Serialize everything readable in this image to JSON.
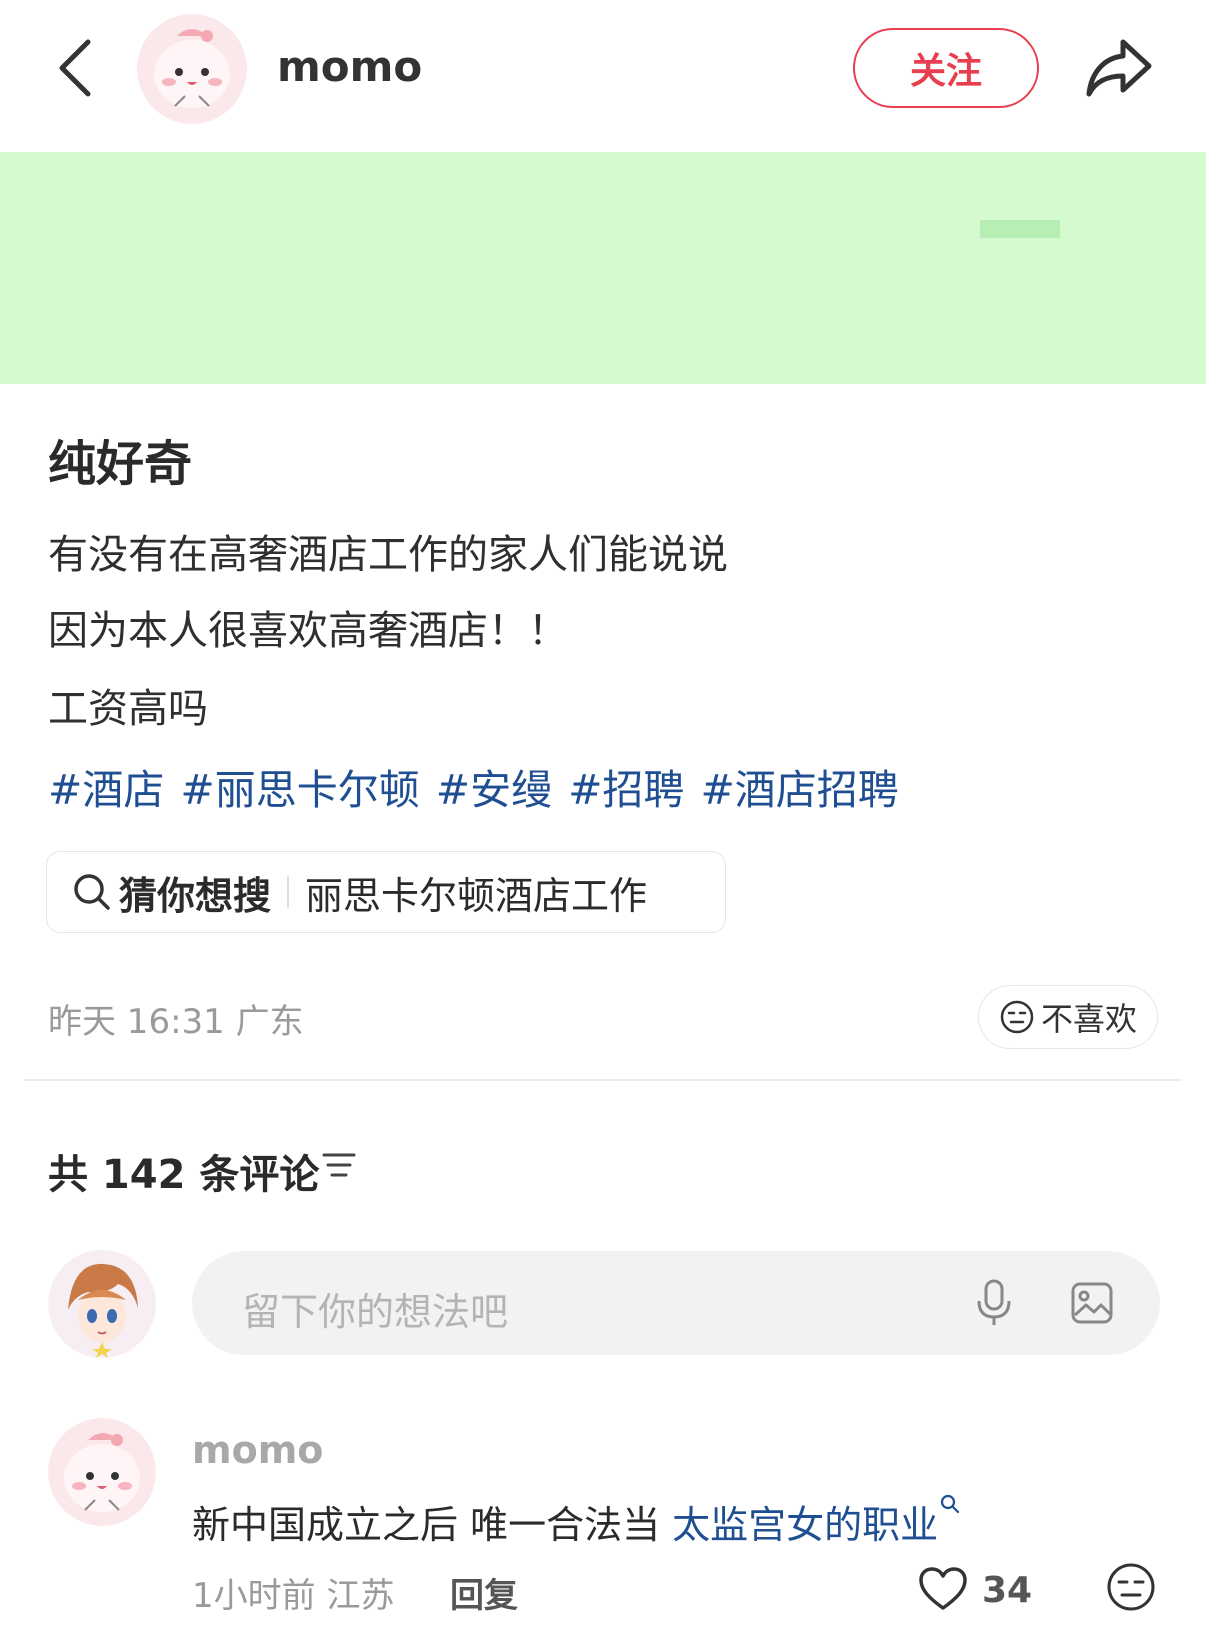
{
  "header": {
    "username": "momo",
    "follow_label": "关注",
    "icons": {
      "back": "chevron-left-icon",
      "share": "share-arrow-icon"
    }
  },
  "post": {
    "title": "纯好奇",
    "lines": [
      "有没有在高奢酒店工作的家人们能说说",
      "因为本人很喜欢高奢酒店！！",
      "工资高吗"
    ],
    "hashtags": [
      "#酒店",
      "#丽思卡尔顿",
      "#安缦",
      "#招聘",
      "#酒店招聘"
    ],
    "search_suggest": {
      "label": "猜你想搜",
      "query": "丽思卡尔顿酒店工作"
    },
    "meta": "昨天 16:31 广东",
    "dislike_label": "不喜欢"
  },
  "comments_section": {
    "count_label": "共 142 条评论",
    "input_placeholder": "留下你的想法吧",
    "items": [
      {
        "username": "momo",
        "text_plain": "新中国成立之后 唯一合法当 ",
        "text_link": "太监宫女的职业",
        "time_location": "1小时前 江苏",
        "reply_label": "回复",
        "likes": "34"
      }
    ]
  },
  "colors": {
    "accent_red": "#e83e4e",
    "link_blue": "#1f4f92",
    "image_bg": "#d5fad0",
    "muted": "#9a9a9a"
  }
}
